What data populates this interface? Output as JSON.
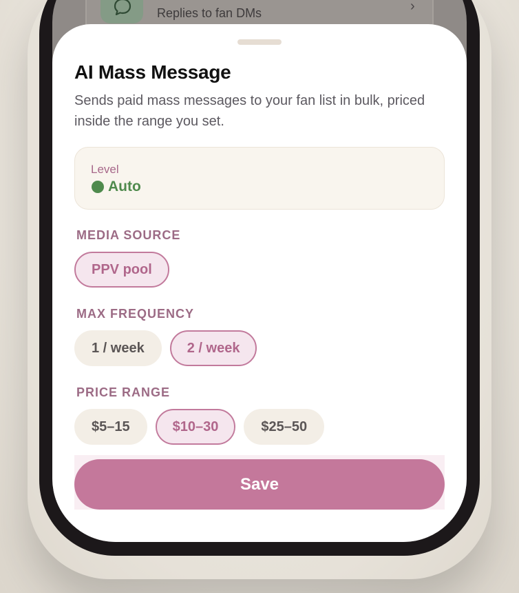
{
  "background": {
    "item_subtitle": "Replies to fan DMs",
    "item_icon": "chat-bubble-icon"
  },
  "sheet": {
    "title": "AI Mass Message",
    "description": "Sends paid mass messages to your fan list in bulk, priced inside the range you set.",
    "level": {
      "label": "Level",
      "value": "Auto",
      "status_color": "#4f8a4d"
    },
    "media_source": {
      "label": "MEDIA SOURCE",
      "options": [
        "PPV pool"
      ],
      "selected": "PPV pool"
    },
    "max_frequency": {
      "label": "MAX FREQUENCY",
      "options": [
        "1 / week",
        "2 / week"
      ],
      "selected": "2 / week"
    },
    "price_range": {
      "label": "PRICE RANGE",
      "options": [
        "$5–15",
        "$10–30",
        "$25–50"
      ],
      "selected": "$10–30"
    },
    "save_label": "Save"
  },
  "colors": {
    "accent": "#c4789b",
    "accent_text": "#b0668b",
    "label": "#9c6b85",
    "chip_bg": "#f3eee6"
  }
}
